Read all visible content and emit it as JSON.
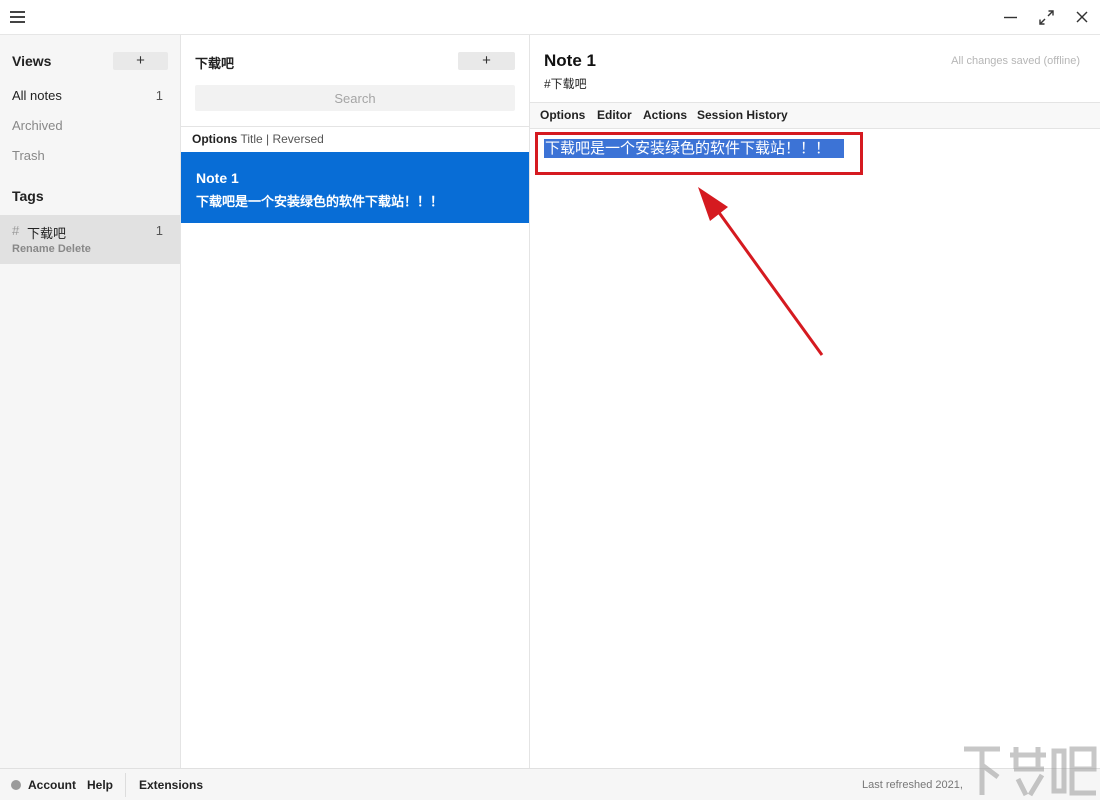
{
  "window": {
    "minimize_icon": "minimize-icon",
    "maximize_icon": "maximize-icon",
    "close_icon": "close-icon"
  },
  "views": {
    "title": "Views",
    "add_label": "+",
    "items": [
      {
        "label": "All notes",
        "count": "1"
      },
      {
        "label": "Archived"
      },
      {
        "label": "Trash"
      }
    ]
  },
  "tags": {
    "title": "Tags",
    "items": [
      {
        "hash": "#",
        "name": "下载吧",
        "count": "1",
        "rename": "Rename",
        "delete": "Delete"
      }
    ]
  },
  "notes": {
    "title": "下载吧",
    "add_label": "+",
    "search_placeholder": "Search",
    "options_label": "Options",
    "options_detail": "Title | Reversed",
    "items": [
      {
        "title": "Note 1",
        "preview": "下载吧是一个安装绿色的软件下载站！！！"
      }
    ]
  },
  "editor": {
    "title": "Note 1",
    "tag": "#下载吧",
    "status": "All changes saved (offline)",
    "menu": [
      "Options",
      "Editor",
      "Actions",
      "Session History"
    ],
    "content": "下载吧是一个安装绿色的软件下载站！！！"
  },
  "footer": {
    "account": "Account",
    "help": "Help",
    "extensions": "Extensions",
    "last_refreshed": "Last refreshed 2021,"
  },
  "colors": {
    "selection": "#086dd6",
    "annotation": "#d51a20",
    "text_highlight": "#3c73d6"
  }
}
